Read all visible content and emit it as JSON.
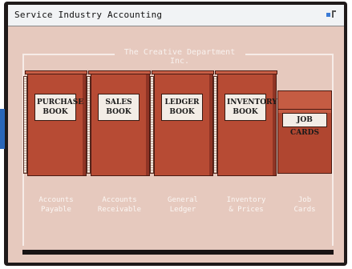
{
  "window": {
    "title": "Service Industry Accounting"
  },
  "company": {
    "name": "The Creative Department Inc."
  },
  "books": [
    {
      "label": "PURCHASE\nBOOK",
      "caption": "Accounts\nPayable"
    },
    {
      "label": "SALES\nBOOK",
      "caption": "Accounts\nReceivable"
    },
    {
      "label": "LEDGER\nBOOK",
      "caption": "General\nLedger"
    },
    {
      "label": "INVENTORY\nBOOK",
      "caption": "Inventory\n& Prices"
    }
  ],
  "job_cards": {
    "label": "JOB CARDS",
    "caption": "Job\nCards"
  },
  "colors": {
    "book_red": "#b74b34",
    "background_pink": "#e6c9be",
    "title_bar": "#f1f3f5",
    "accent_blue": "#2a66b8"
  }
}
